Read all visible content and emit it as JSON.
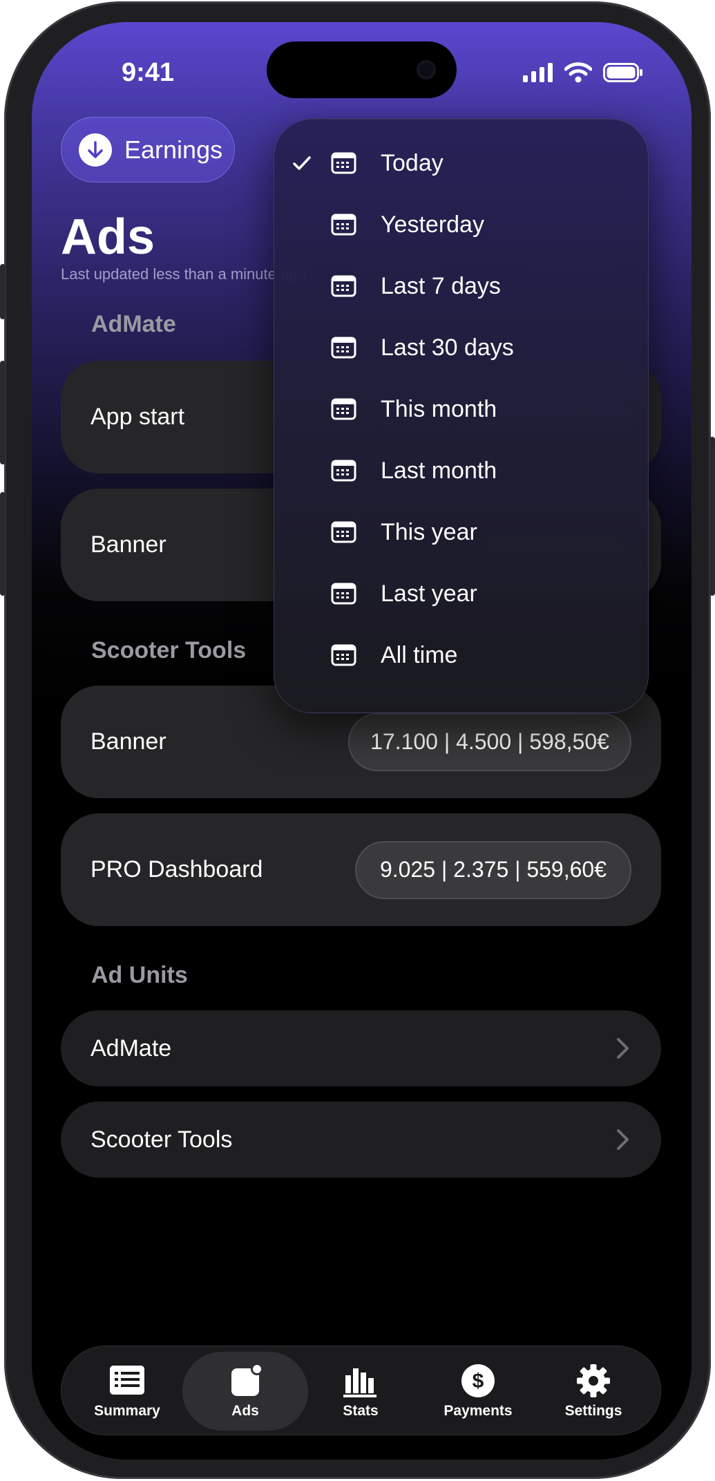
{
  "status_bar": {
    "time": "9:41"
  },
  "header": {
    "earnings_label": "Earnings",
    "title": "Ads",
    "subtitle": "Last updated less than a minute ago"
  },
  "sections": {
    "admate": {
      "title": "AdMate",
      "rows": [
        {
          "label": "App start"
        },
        {
          "label": "Banner"
        }
      ]
    },
    "scooter_tools": {
      "title": "Scooter Tools",
      "rows": [
        {
          "label": "Banner",
          "stats": "17.100 | 4.500 | 598,50€"
        },
        {
          "label": "PRO Dashboard",
          "stats": "9.025 | 2.375 | 559,60€"
        }
      ]
    },
    "ad_units": {
      "title": "Ad Units",
      "rows": [
        {
          "label": "AdMate"
        },
        {
          "label": "Scooter Tools"
        }
      ]
    }
  },
  "dropdown": {
    "selected": "Today",
    "options": [
      "Today",
      "Yesterday",
      "Last 7 days",
      "Last 30 days",
      "This month",
      "Last month",
      "This year",
      "Last year",
      "All time"
    ]
  },
  "tabbar": {
    "tabs": [
      {
        "label": "Summary",
        "icon": "list-icon"
      },
      {
        "label": "Ads",
        "icon": "ads-icon"
      },
      {
        "label": "Stats",
        "icon": "bar-chart-icon"
      },
      {
        "label": "Payments",
        "icon": "dollar-icon"
      },
      {
        "label": "Settings",
        "icon": "gear-icon"
      }
    ],
    "active": "Ads"
  },
  "colors": {
    "accent_top": "#5a47cf",
    "card_bg": "#262628",
    "pill_bg": "#3a3a3c"
  }
}
